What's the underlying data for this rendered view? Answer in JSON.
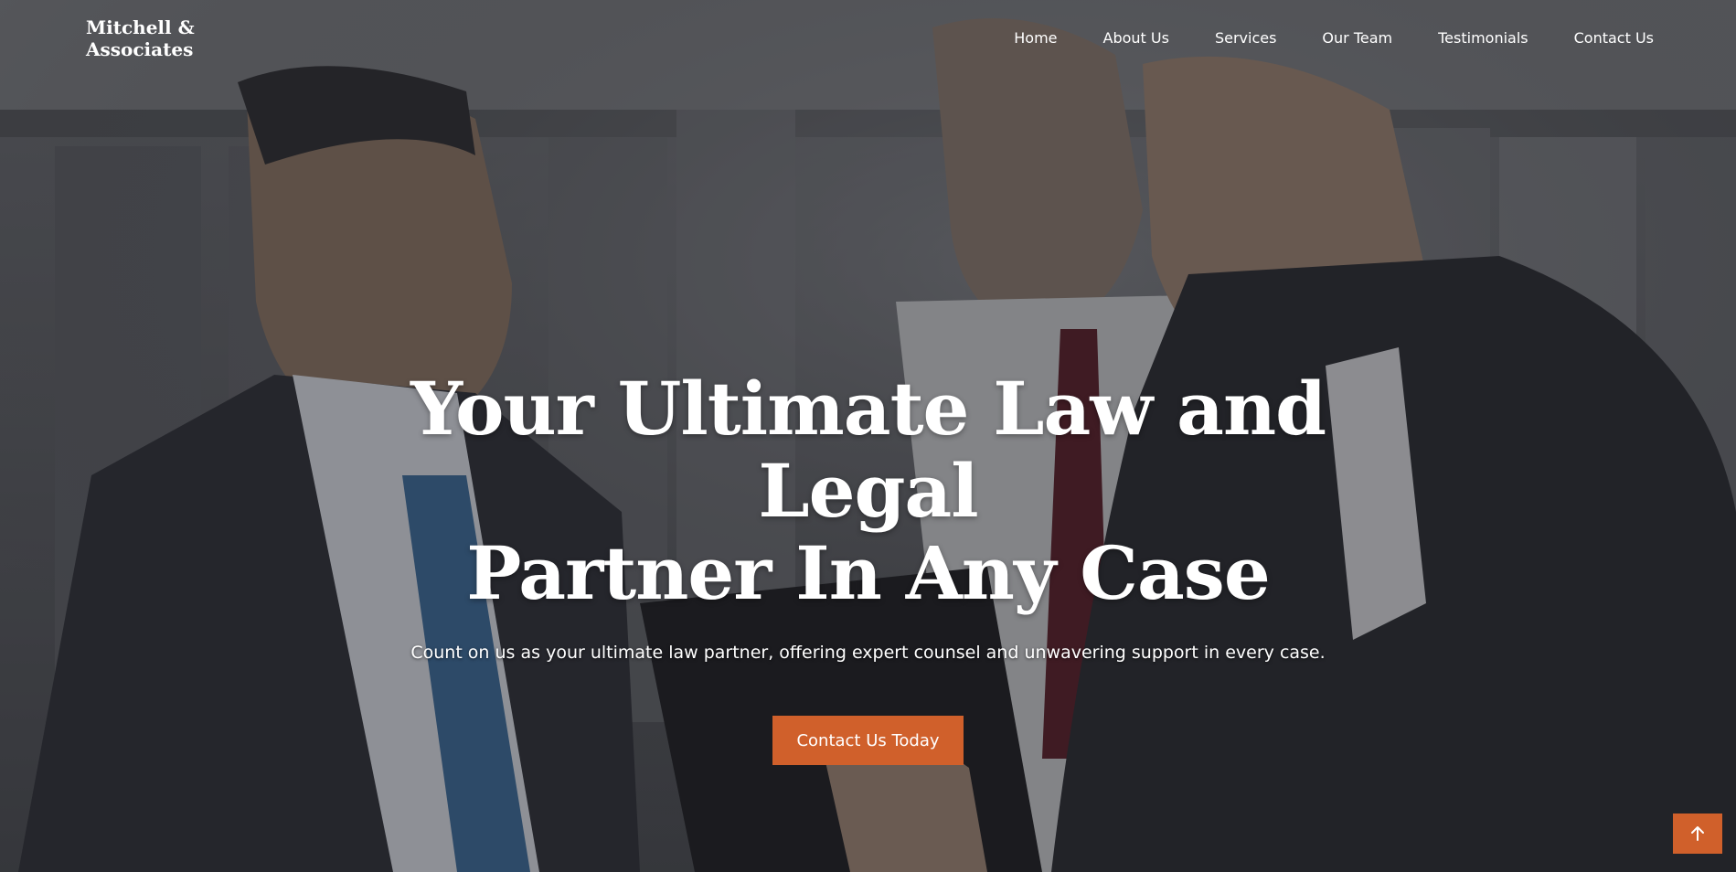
{
  "brand": {
    "name": "Mitchell & Associates",
    "accent_color": "#d0602b"
  },
  "nav": {
    "items": [
      {
        "label": "Home"
      },
      {
        "label": "About Us"
      },
      {
        "label": "Services"
      },
      {
        "label": "Our Team"
      },
      {
        "label": "Testimonials"
      },
      {
        "label": "Contact Us"
      }
    ]
  },
  "hero": {
    "title_line1": "Your Ultimate Law and Legal",
    "title_line2": "Partner In Any Case",
    "subtitle": "Count on us as your ultimate law partner, offering expert counsel and unwavering support in every case.",
    "cta_label": "Contact Us Today",
    "background_icon": "office-photo"
  },
  "back_to_top": {
    "icon": "arrow-up-icon"
  }
}
